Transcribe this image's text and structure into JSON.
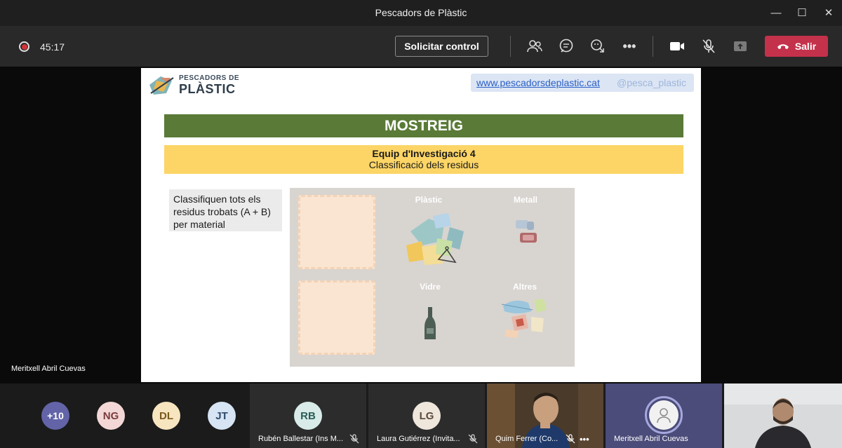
{
  "window": {
    "title": "Pescadors de Plàstic"
  },
  "toolbar": {
    "timer": "45:17",
    "request_control_label": "Solicitar control",
    "leave_label": "Salir"
  },
  "slide": {
    "logo": {
      "line1": "PESCADORS DE",
      "line2": "PLÀSTIC"
    },
    "url": "www.pescadorsdeplastic.cat",
    "handle": "@pesca_plastic",
    "heading": "MOSTREIG",
    "team": "Equip d'Investigació 4",
    "subtitle": "Classificació dels residus",
    "instruction": "Classifiquen tots els residus trobats (A + B) per material",
    "categories": {
      "plastic": "Plàstic",
      "metal": "Metall",
      "glass": "Vidre",
      "other": "Altres"
    }
  },
  "stage": {
    "presenter_name": "Meritxell Abril Cuevas"
  },
  "participants": {
    "overflow": "+10",
    "avatars": [
      {
        "initials": "NG",
        "bg": "#f3d7d7",
        "fg": "#7a3b3b"
      },
      {
        "initials": "DL",
        "bg": "#f7e5c0",
        "fg": "#7a5a1e"
      },
      {
        "initials": "JT",
        "bg": "#d6e4f3",
        "fg": "#2f4b6d"
      }
    ],
    "tiles": [
      {
        "initials": "RB",
        "name": "Rubén Ballestar (Ins M..."
      },
      {
        "initials": "LG",
        "name": "Laura Gutiérrez (Invita..."
      },
      {
        "name": "Quim Ferrer (Co..."
      },
      {
        "name": "Meritxell Abril Cuevas"
      }
    ]
  },
  "colors": {
    "leave": "#c4314b",
    "green": "#5a7a37",
    "yellow": "#fcd566",
    "overflow": "#6264a7"
  }
}
